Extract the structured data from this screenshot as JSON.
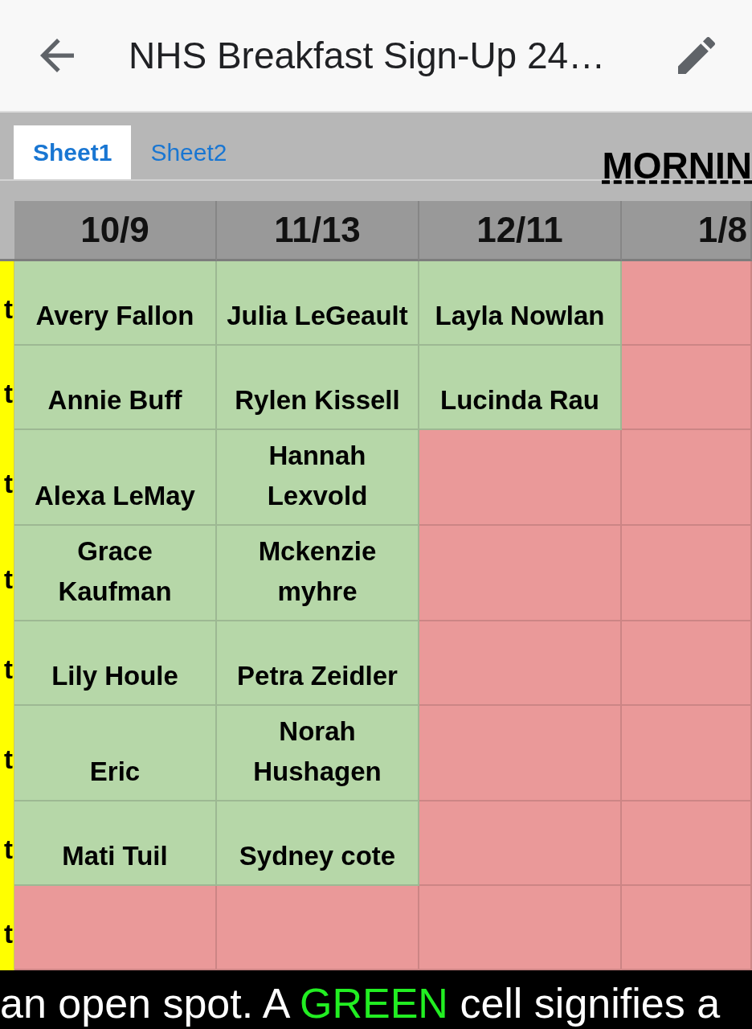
{
  "app_bar": {
    "title": "NHS Breakfast Sign-Up 24…"
  },
  "sheet_tabs": [
    {
      "label": "Sheet1",
      "selected": true
    },
    {
      "label": "Sheet2",
      "selected": false
    }
  ],
  "sheet_title": "MORNIN",
  "columns": [
    "10/9",
    "11/13",
    "12/11",
    "1/8"
  ],
  "rows": [
    {
      "label": "t",
      "cells": [
        {
          "name": "Avery Fallon",
          "filled": true
        },
        {
          "name": "Julia LeGeault",
          "filled": true
        },
        {
          "name": "Layla Nowlan",
          "filled": true
        },
        {
          "filled": false
        }
      ]
    },
    {
      "label": "t",
      "cells": [
        {
          "name": "Annie Buff",
          "filled": true
        },
        {
          "name": "Rylen Kissell",
          "filled": true
        },
        {
          "name": "Lucinda Rau",
          "filled": true
        },
        {
          "filled": false
        }
      ]
    },
    {
      "label": "t",
      "cells": [
        {
          "name": "Alexa LeMay",
          "filled": true
        },
        {
          "name": "Hannah Lexvold",
          "filled": true
        },
        {
          "filled": false
        },
        {
          "filled": false
        }
      ]
    },
    {
      "label": "t",
      "cells": [
        {
          "name": "Grace Kaufman",
          "filled": true
        },
        {
          "name": "Mckenzie myhre",
          "filled": true
        },
        {
          "filled": false
        },
        {
          "filled": false
        }
      ]
    },
    {
      "label": "t",
      "cells": [
        {
          "name": "Lily Houle",
          "filled": true
        },
        {
          "name": "Petra Zeidler",
          "filled": true
        },
        {
          "filled": false
        },
        {
          "filled": false
        }
      ]
    },
    {
      "label": "t",
      "cells": [
        {
          "name": "Eric",
          "filled": true
        },
        {
          "name": "Norah Hushagen",
          "filled": true
        },
        {
          "filled": false
        },
        {
          "filled": false
        }
      ]
    },
    {
      "label": "t",
      "cells": [
        {
          "name": "Mati Tuil",
          "filled": true
        },
        {
          "name": "Sydney cote",
          "filled": true
        },
        {
          "filled": false
        },
        {
          "filled": false
        }
      ]
    },
    {
      "label": "t",
      "cells": [
        {
          "filled": false
        },
        {
          "filled": false
        },
        {
          "filled": false
        },
        {
          "filled": false
        }
      ]
    }
  ],
  "caption": {
    "parts": [
      {
        "text": "an open spot. A",
        "color": "#ffffff"
      },
      {
        "text": "GREEN",
        "color": "#22ee22"
      },
      {
        "text": "cell signifies a",
        "color": "#ffffff"
      }
    ]
  }
}
